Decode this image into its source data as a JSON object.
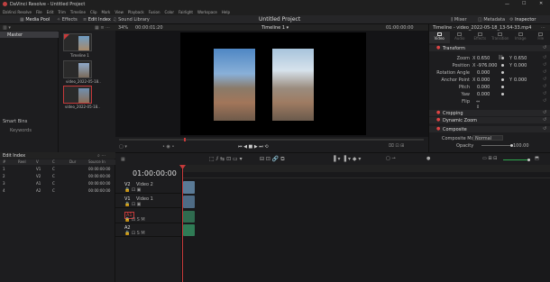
{
  "app": {
    "window_title": "DaVinci Resolve - Untitled Project",
    "project_title": "Untitled Project",
    "menu": [
      "DaVinci Resolve",
      "File",
      "Edit",
      "Trim",
      "Timeline",
      "Clip",
      "Mark",
      "View",
      "Playback",
      "Fusion",
      "Color",
      "Fairlight",
      "Workspace",
      "Help"
    ],
    "toolbar_left": [
      "Media Pool",
      "Effects",
      "Edit Index",
      "Sound Library"
    ],
    "toolbar_right": [
      "Mixer",
      "Metadata",
      "Inspector"
    ]
  },
  "viewer": {
    "zoom": "34%",
    "timecode_left": "00:00:01:20",
    "timeline_name": "Timeline 1",
    "timecode_right": "01:00:00:00"
  },
  "media_pool": {
    "bins": [
      "Master"
    ],
    "smart_bins": "Smart Bins",
    "keywords": "Keywords",
    "clips": [
      "Timeline 1",
      "video_2022-05-18..",
      "video_2022-05-18.."
    ]
  },
  "edit_index": {
    "title": "Edit Index",
    "columns": [
      "#",
      "Reel",
      "V",
      "C",
      "Dur",
      "Source In"
    ],
    "rows": [
      {
        "n": "1",
        "reel": "",
        "v": "V1",
        "c": "C",
        "dur": "",
        "src": "00:00:00:00"
      },
      {
        "n": "2",
        "reel": "",
        "v": "V2",
        "c": "C",
        "dur": "",
        "src": "00:00:00:00"
      },
      {
        "n": "3",
        "reel": "",
        "v": "A1",
        "c": "C",
        "dur": "",
        "src": "00:00:00:00"
      },
      {
        "n": "4",
        "reel": "",
        "v": "A2",
        "c": "C",
        "dur": "",
        "src": "00:00:00:00"
      }
    ]
  },
  "timeline": {
    "timecode": "01:00:00:00",
    "tracks": [
      {
        "id": "V2",
        "name": "Video 2"
      },
      {
        "id": "V1",
        "name": "Video 1"
      },
      {
        "id": "A1",
        "name": ""
      },
      {
        "id": "A2",
        "name": ""
      }
    ],
    "audio_level": "2.0"
  },
  "inspector": {
    "header": "Timeline - video_2022-05-18_13-54-33.mp4",
    "tabs": [
      "Video",
      "Audio",
      "Effects",
      "Transition",
      "Image",
      "File"
    ],
    "sections": {
      "transform": "Transform",
      "cropping": "Cropping",
      "dynamic_zoom": "Dynamic Zoom",
      "composite": "Composite"
    },
    "transform_fields": [
      {
        "label": "Zoom",
        "x_label": "X",
        "x": "0.650",
        "y_label": "Y",
        "y": "0.650"
      },
      {
        "label": "Position",
        "x_label": "X",
        "x": "-976.000",
        "y_label": "Y",
        "y": "0.000"
      },
      {
        "label": "Rotation Angle",
        "x": "0.000"
      },
      {
        "label": "Anchor Point",
        "x_label": "X",
        "x": "0.000",
        "y_label": "Y",
        "y": "0.000"
      },
      {
        "label": "Pitch",
        "x": "0.000"
      },
      {
        "label": "Yaw",
        "x": "0.000"
      },
      {
        "label": "Flip"
      }
    ],
    "composite": {
      "mode_label": "Composite Mode",
      "mode_value": "Normal",
      "opacity_label": "Opacity",
      "opacity_value": "100.00"
    }
  },
  "colors": {
    "accent_red": "#c63a3a",
    "bg_dark": "#141416",
    "clip_video": "#5a7a96",
    "clip_audio": "#2f6b4f"
  }
}
